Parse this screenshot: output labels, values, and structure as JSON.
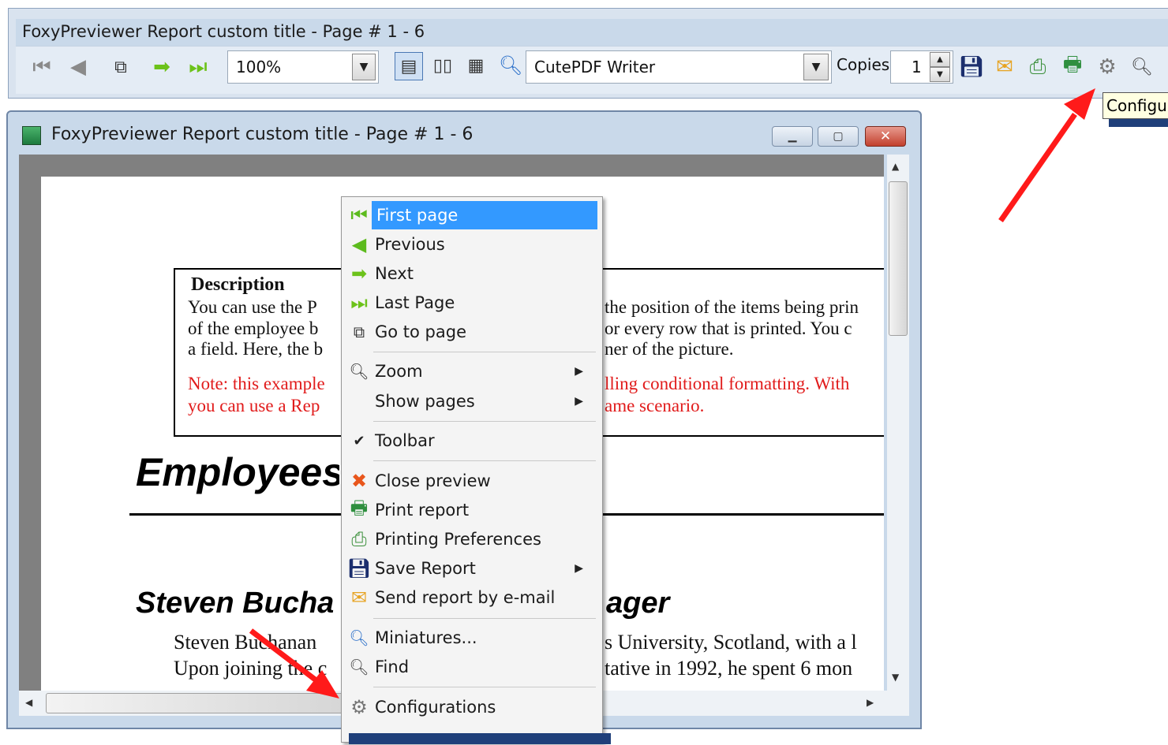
{
  "toolbar_window": {
    "title": "FoxyPreviewer Report custom title - Page # 1 - 6",
    "zoom_value": "100%",
    "printer_value": "CutePDF Writer",
    "copies_label": "Copies",
    "copies_value": "1",
    "tooltip": "Configurations",
    "icons": [
      "first-page-icon",
      "previous-icon",
      "goto-page-icon",
      "next-icon",
      "last-page-icon",
      "one-page-icon",
      "two-pages-icon",
      "four-pages-icon",
      "zoom-icon",
      "save-icon",
      "email-icon",
      "printing-preferences-icon",
      "print-icon",
      "configurations-icon",
      "find-icon"
    ]
  },
  "preview_window": {
    "title": "FoxyPreviewer Report custom title - Page # 1 - 6",
    "report": {
      "description_heading": "Description",
      "desc_line1_left": "You can use the P",
      "desc_line1_right": "the position of the items being prin",
      "desc_line2_left": "of the employee b",
      "desc_line2_right": "or every row that is printed.  You c",
      "desc_line3_left": "a field.  Here, the b",
      "desc_line3_right": "ner of the picture.",
      "note_line1_left": "Note: this example",
      "note_line1_right": "lling conditional formatting. With",
      "note_line2_left": "you can use a Rep",
      "note_line2_right": "ame scenario.",
      "heading_employees": "Employees",
      "heading_steven_left": "Steven Bucha",
      "heading_steven_right": "ager",
      "body_line1_left": "Steven Buchanan",
      "body_line1_right": "s University, Scotland, with a l",
      "body_line2_left": "Upon joining the c",
      "body_line2_right": "tative in 1992, he spent 6 mon"
    }
  },
  "context_menu": {
    "items": [
      {
        "label": "First page",
        "icon": "first-page-icon",
        "highlighted": true
      },
      {
        "label": "Previous",
        "icon": "previous-icon"
      },
      {
        "label": "Next",
        "icon": "next-icon"
      },
      {
        "label": "Last Page",
        "icon": "last-page-icon"
      },
      {
        "label": "Go to page",
        "icon": "goto-page-icon"
      },
      {
        "label": "Zoom",
        "icon": "zoom-icon",
        "submenu": true
      },
      {
        "label": "Show pages",
        "icon": "",
        "submenu": true
      },
      {
        "label": "Toolbar",
        "icon": "check-icon",
        "checked": true
      },
      {
        "label": "Close preview",
        "icon": "close-icon"
      },
      {
        "label": "Print report",
        "icon": "print-icon"
      },
      {
        "label": "Printing Preferences",
        "icon": "printing-preferences-icon"
      },
      {
        "label": "Save Report",
        "icon": "save-icon",
        "submenu": true
      },
      {
        "label": "Send report by e-mail",
        "icon": "email-icon"
      },
      {
        "label": "Miniatures...",
        "icon": "miniatures-icon"
      },
      {
        "label": "Find",
        "icon": "find-icon"
      },
      {
        "label": "Configurations",
        "icon": "configurations-icon"
      }
    ]
  },
  "colors": {
    "highlight": "#3399ff",
    "annotation_arrow": "#ff1a1a",
    "note_text": "#e11b1b"
  }
}
